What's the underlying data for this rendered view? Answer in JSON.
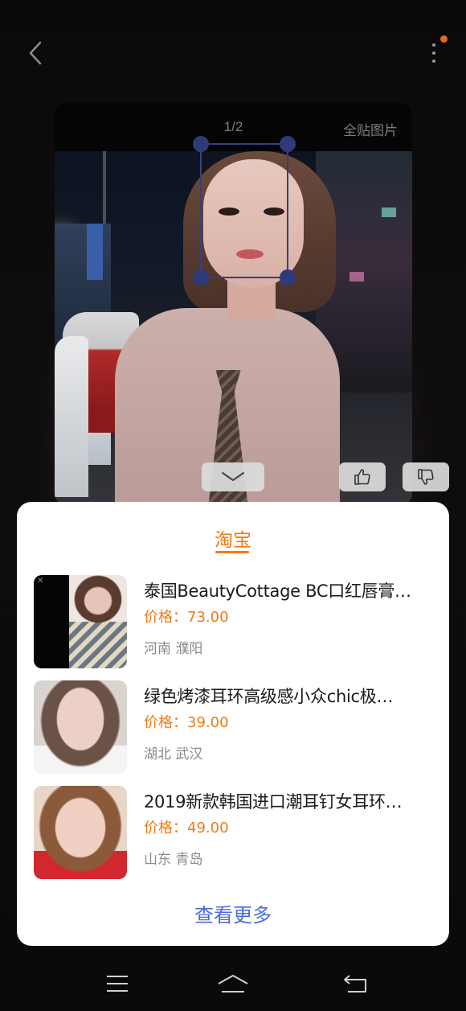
{
  "header": {
    "back_icon": "chevron-left-icon",
    "more_icon": "more-vertical-icon",
    "badge_color": "#e06b1c"
  },
  "image_viewer": {
    "page_indicator": "1/2",
    "fit_image_label": "全贴图片"
  },
  "actions": {
    "collapse_icon": "chevron-down-icon",
    "like_icon": "thumbs-up-icon",
    "dislike_icon": "thumbs-down-icon"
  },
  "results": {
    "source_tab": "淘宝",
    "accent_color": "#f07a14",
    "products": [
      {
        "title": "泰国BeautyCottage BC口红唇膏…",
        "price": "价格：73.00",
        "location": "河南 濮阳"
      },
      {
        "title": "绿色烤漆耳环高级感小众chic极…",
        "price": "价格：39.00",
        "location": "湖北 武汉"
      },
      {
        "title": "2019新款韩国进口潮耳钉女耳环…",
        "price": "价格：49.00",
        "location": "山东 青岛"
      }
    ],
    "view_more_label": "查看更多",
    "view_more_color": "#4a6ad8"
  },
  "nav_bar": {
    "menu_icon": "menu-icon",
    "home_icon": "home-icon",
    "back_icon": "return-icon"
  }
}
